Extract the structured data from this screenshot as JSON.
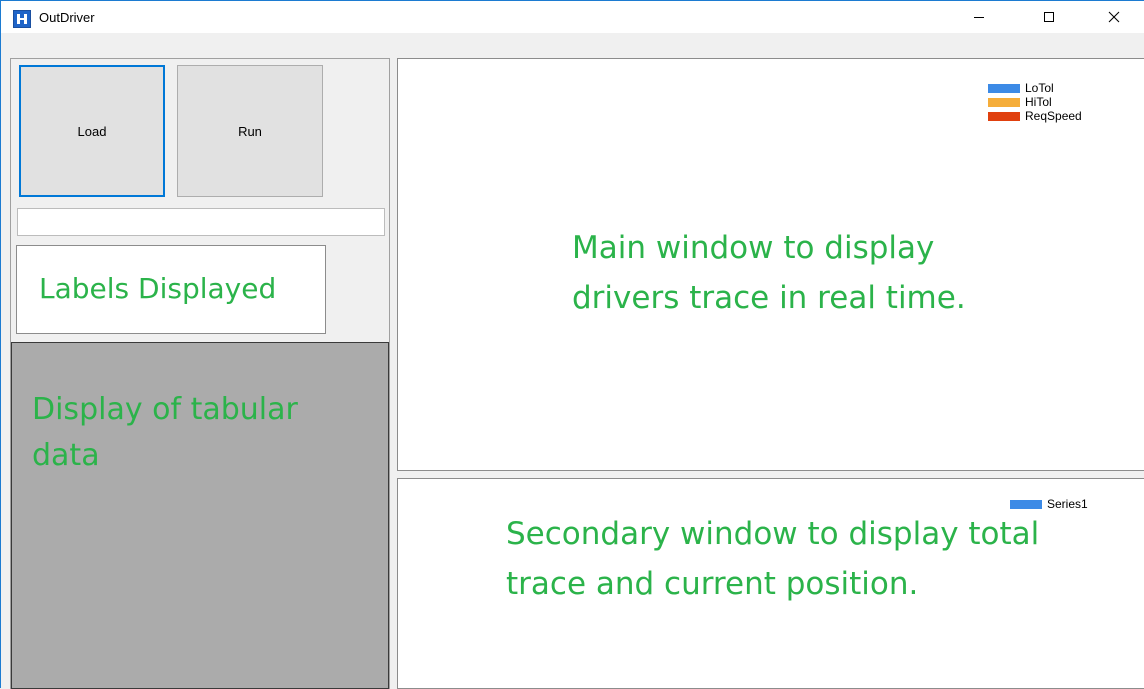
{
  "window": {
    "title": "OutDriver",
    "controls": {
      "minimize": "minimize-icon",
      "maximize": "maximize-icon",
      "close": "close-icon"
    }
  },
  "toolbar": {
    "load_label": "Load",
    "run_label": "Run"
  },
  "labels_box": {
    "text": "Labels Displayed"
  },
  "table_area": {
    "text": "Display of tabular data"
  },
  "main_chart": {
    "legend": [
      {
        "label": "LoTol",
        "color": "#3c8ae6"
      },
      {
        "label": "HiTol",
        "color": "#f5ad3a"
      },
      {
        "label": "ReqSpeed",
        "color": "#e0400e"
      }
    ],
    "note": "Main window to display drivers trace in real time."
  },
  "secondary_chart": {
    "legend": [
      {
        "label": "Series1",
        "color": "#3c8ae6"
      }
    ],
    "note": "Secondary window to display total trace and current position."
  },
  "colors": {
    "annotation": "#2bb34a",
    "accent": "#0078d7"
  }
}
